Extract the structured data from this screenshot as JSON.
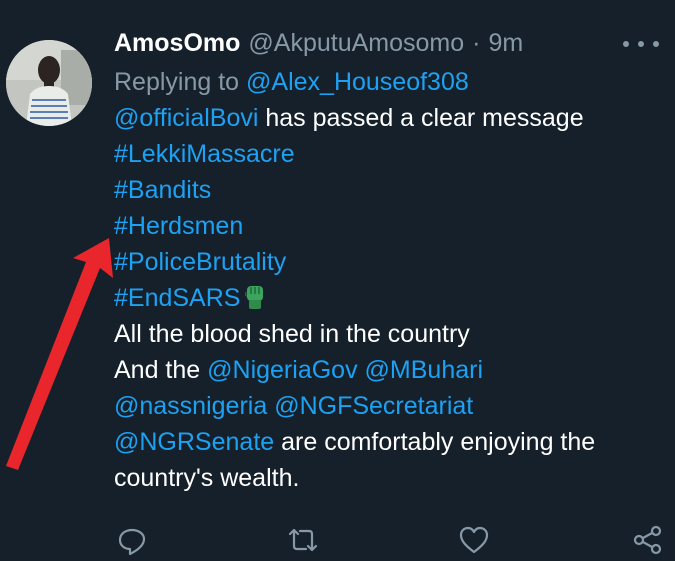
{
  "tweet": {
    "display_name": "AmosOmo",
    "handle": "@AkputuAmosomo",
    "separator": "·",
    "time": "9m",
    "reply_prefix": "Replying to",
    "reply_to": "@Alex_Houseof308",
    "body": {
      "line1_mention": "@officialBovi",
      "line1_text": " has passed a clear message",
      "hashtags": [
        "#LekkiMassacre",
        "#Bandits",
        "#Herdsmen",
        "#PoliceBrutality",
        "#EndSARS"
      ],
      "line7_text": "All the blood shed in the country",
      "line8_text": "And the ",
      "line8_mention1": "@NigeriaGov",
      "line8_mention2": "@MBuhari",
      "line9_mention1": "@nassnigeria",
      "line9_mention2": "@NGFSecretariat",
      "line10_mention": "@NGRSenate",
      "line10_text": " are comfortably enjoying the",
      "line11_text": "country's wealth."
    },
    "emoji_icon": "raised-fist-green-icon"
  },
  "colors": {
    "background": "#15202b",
    "link": "#1da1f2",
    "muted": "#8899a6",
    "annotation_arrow": "#e8262c"
  },
  "icons": [
    "more-icon",
    "reply-icon",
    "retweet-icon",
    "like-icon",
    "share-icon"
  ]
}
